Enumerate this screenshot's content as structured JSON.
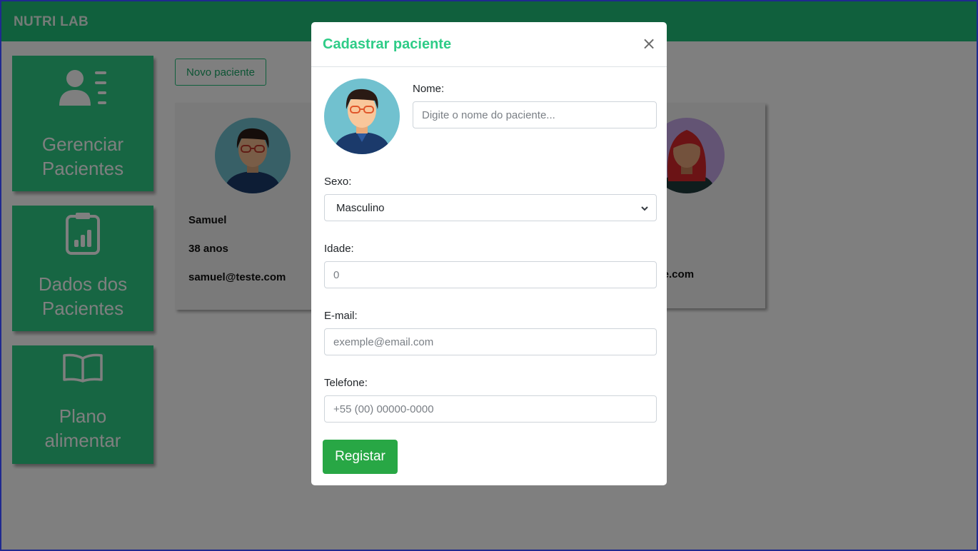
{
  "app": {
    "brand": "NUTRI LAB"
  },
  "sidebar": {
    "items": [
      {
        "label": "Gerenciar\nPacientes",
        "icon": "users-list-icon"
      },
      {
        "label": "Dados dos\nPacientes",
        "icon": "clipboard-chart-icon"
      },
      {
        "label": "Plano\nalimentar",
        "icon": "book-icon"
      }
    ]
  },
  "main": {
    "new_patient_label": "Novo paciente",
    "patients": [
      {
        "name": "Samuel",
        "age": "38 anos",
        "email": "samuel@teste.com",
        "avatar": "male-avatar-icon"
      },
      {
        "email_partial": "teste.com",
        "avatar": "female-avatar-icon"
      }
    ]
  },
  "modal": {
    "title": "Cadastrar paciente",
    "close_glyph": "×",
    "avatar": "male-avatar-icon",
    "fields": {
      "nome": {
        "label": "Nome:",
        "placeholder": "Digite o nome do paciente..."
      },
      "sexo": {
        "label": "Sexo:",
        "value": "Masculino"
      },
      "idade": {
        "label": "Idade:",
        "placeholder": "0"
      },
      "email": {
        "label": "E-mail:",
        "placeholder": "exemple@email.com"
      },
      "telefone": {
        "label": "Telefone:",
        "placeholder": "+55 (00) 00000-0000"
      }
    },
    "submit_label": "Registar"
  },
  "colors": {
    "brand_green": "#20c07a",
    "card_green": "#2ecc87",
    "submit_green": "#28a745",
    "frame_border": "#1f2a8f"
  }
}
